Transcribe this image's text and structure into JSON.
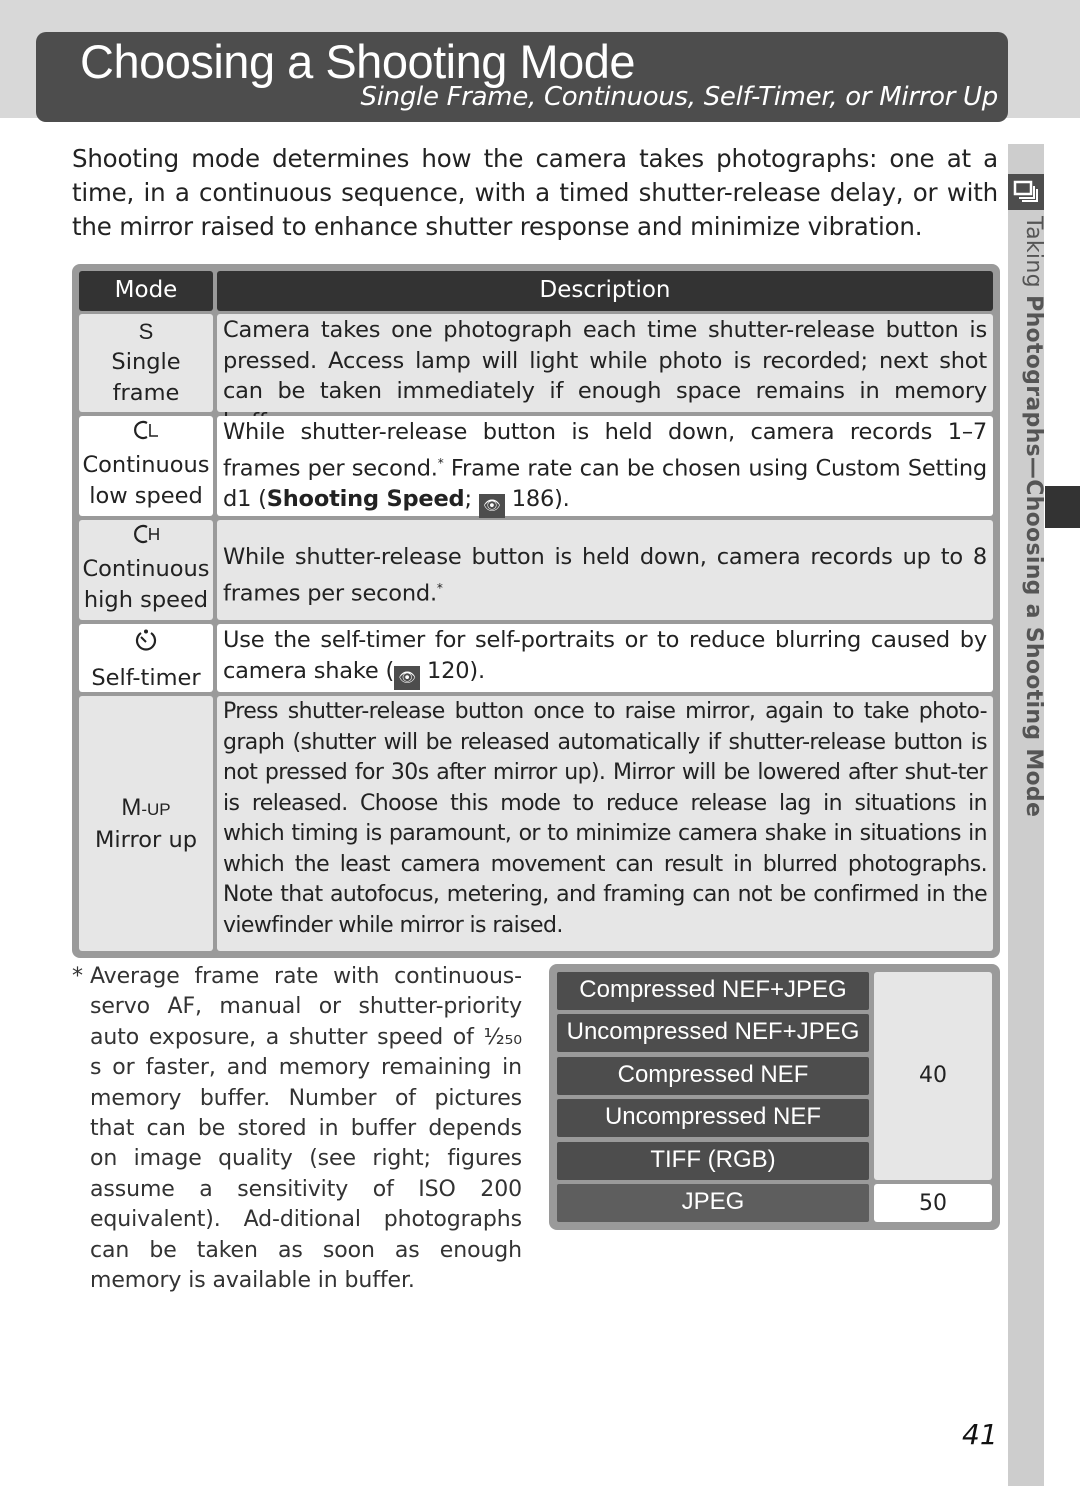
{
  "header": {
    "title": "Choosing a Shooting Mode",
    "subtitle": "Single Frame, Continuous, Self-Timer, or Mirror Up"
  },
  "intro": "Shooting mode determines how the camera takes photographs: one at a time, in a continuous sequence, with a timed shutter-release delay, or with the mirror raised to enhance shutter response and minimize vibration.",
  "side_tab": {
    "icon": "shooting-menu-icon",
    "label_prefix": "Taking ",
    "label_bold": "Photographs—Choosing a Shooting Mode"
  },
  "table": {
    "headers": [
      "Mode",
      "Description"
    ],
    "rows": [
      {
        "symbol": "S",
        "name_line1": "Single",
        "name_line2": "frame",
        "description": "Camera takes one photograph each time shutter-release button is pressed.  Access lamp will light while photo is recorded; next shot can be taken immediately if enough space remains in memory buffer."
      },
      {
        "symbol": "CL",
        "name_line1": "Continuous",
        "name_line2": "low speed",
        "description_pre": "While shutter-release button is held down, camera records 1–7 frames per second.",
        "description_mid": "  Frame rate can be chosen using Custom Setting d1 (",
        "description_bold": "Shooting Speed",
        "description_ref_sep": "; ",
        "description_ref": "186",
        "description_end": ")."
      },
      {
        "symbol": "CH",
        "name_line1": "Continuous",
        "name_line2": "high speed",
        "description": "While shutter-release button is held down, camera records up to 8 frames per second."
      },
      {
        "symbol": "self-timer-symbol",
        "name_line1": "Self-timer",
        "description_pre": "Use the self-timer for self-portraits or to reduce blurring caused by camera shake (",
        "description_ref": "120",
        "description_end": ")."
      },
      {
        "symbol": "M-UP",
        "name_line1": "Mirror up",
        "description": "Press shutter-release button once to raise mirror, again to take photo-graph (shutter will be released automatically if shutter-release button is not pressed for 30s after mirror up).  Mirror will be lowered after shut-ter is released.  Choose this mode to reduce release lag in situations in which timing is paramount, or to minimize camera shake in situations in which the least camera movement can result in blurred photographs. Note that autofocus, metering, and framing can not be confirmed in the viewfinder while mirror is raised."
      }
    ],
    "asterisk": "*"
  },
  "footnote": {
    "marker": "*",
    "text": "Average frame rate with continuous-servo AF, manual or shutter-priority auto exposure, a shutter speed of ¹⁄₂₅₀ s or faster, and memory remaining in memory buffer.  Number of pictures that can be stored in buffer depends on image quality (see right; figures assume a sensitivity of ISO 200 equivalent).  Ad-ditional photographs can be taken as soon as enough memory is available in buffer."
  },
  "buffer_table": {
    "rows": [
      "Compressed NEF+JPEG",
      "Uncompressed NEF+JPEG",
      "Compressed NEF",
      "Uncompressed NEF",
      "TIFF (RGB)",
      "JPEG"
    ],
    "values": [
      {
        "label": "40",
        "applies_to": [
          "Compressed NEF+JPEG",
          "Uncompressed NEF+JPEG",
          "Compressed NEF",
          "Uncompressed NEF",
          "TIFF (RGB)"
        ]
      },
      {
        "label": "50",
        "applies_to": [
          "JPEG"
        ]
      }
    ]
  },
  "page_number": "41"
}
